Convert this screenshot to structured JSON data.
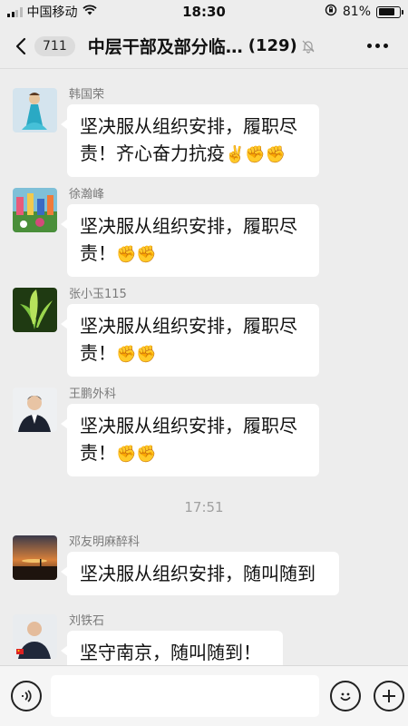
{
  "status": {
    "carrier": "中国移动",
    "time": "18:30",
    "battery": "81%"
  },
  "nav": {
    "unread": "711",
    "title": "中层干部及部分临…",
    "count": "(129)"
  },
  "messages": [
    {
      "sender": "韩国荣",
      "line1": "坚决服从组织安排，履职尽",
      "line2": "责！齐心奋力抗疫"
    },
    {
      "sender": "徐瀚峰",
      "line1": "坚决服从组织安排，履职尽",
      "line2": "责！"
    },
    {
      "sender": "张小玉115",
      "line1": "坚决服从组织安排，履职尽",
      "line2": "责！"
    },
    {
      "sender": "王鹏外科",
      "line1": "坚决服从组织安排，履职尽",
      "line2": "责！"
    },
    {
      "sender": "邓友明麻醉科",
      "line1": "坚决服从组织安排，随叫随到"
    },
    {
      "sender": "刘铁石",
      "line1": "坚守南京，随叫随到！"
    }
  ],
  "time_separator": "17:51",
  "emojis": {
    "victory": "✌️",
    "fist": "✊"
  },
  "icons": {
    "wifi": "wifi-icon",
    "back": "back-arrow-icon",
    "mute": "mute-bell-icon",
    "voice": "voice-icon",
    "emoji": "emoji-icon",
    "plus": "plus-icon"
  },
  "colors": {
    "background": "#ededed",
    "bubble": "#ffffff"
  }
}
